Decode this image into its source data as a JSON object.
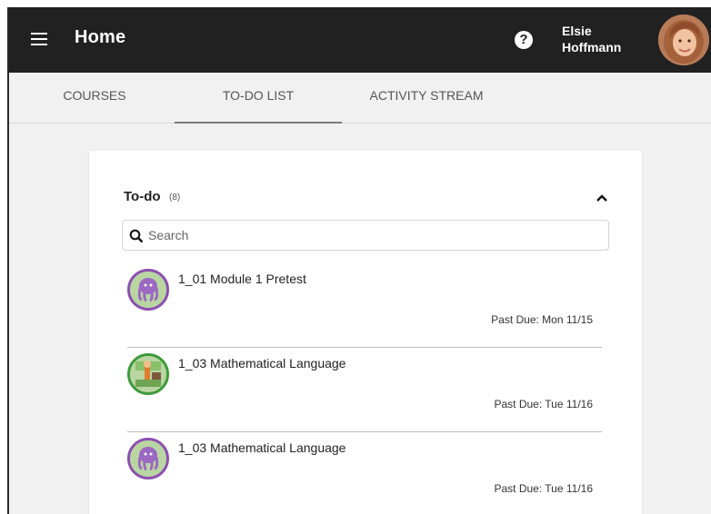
{
  "header": {
    "title": "Home",
    "help_symbol": "?",
    "user_first": "Elsie",
    "user_last": "Hoffmann"
  },
  "tabs": [
    {
      "label": "COURSES",
      "active": false
    },
    {
      "label": "TO-DO LIST",
      "active": true
    },
    {
      "label": "ACTIVITY STREAM",
      "active": false
    }
  ],
  "todo": {
    "title": "To-do",
    "count": "(8)",
    "search_placeholder": "Search",
    "items": [
      {
        "name": "1_01 Module 1 Pretest",
        "due": "Past Due: Mon 11/15",
        "icon": "octopus-icon",
        "ring": "#8c4fb0"
      },
      {
        "name": "1_03 Mathematical Language",
        "due": "Past Due: Tue 11/16",
        "icon": "classroom-icon",
        "ring": "#3e9a3a"
      },
      {
        "name": "1_03 Mathematical Language",
        "due": "Past Due: Tue 11/16",
        "icon": "octopus-icon",
        "ring": "#8c4fb0"
      }
    ]
  },
  "colors": {
    "topbar": "#212121",
    "tab_background": "#f1f1f1",
    "card": "#ffffff",
    "purple_ring": "#8c4fb0",
    "green_ring": "#3e9a3a"
  }
}
